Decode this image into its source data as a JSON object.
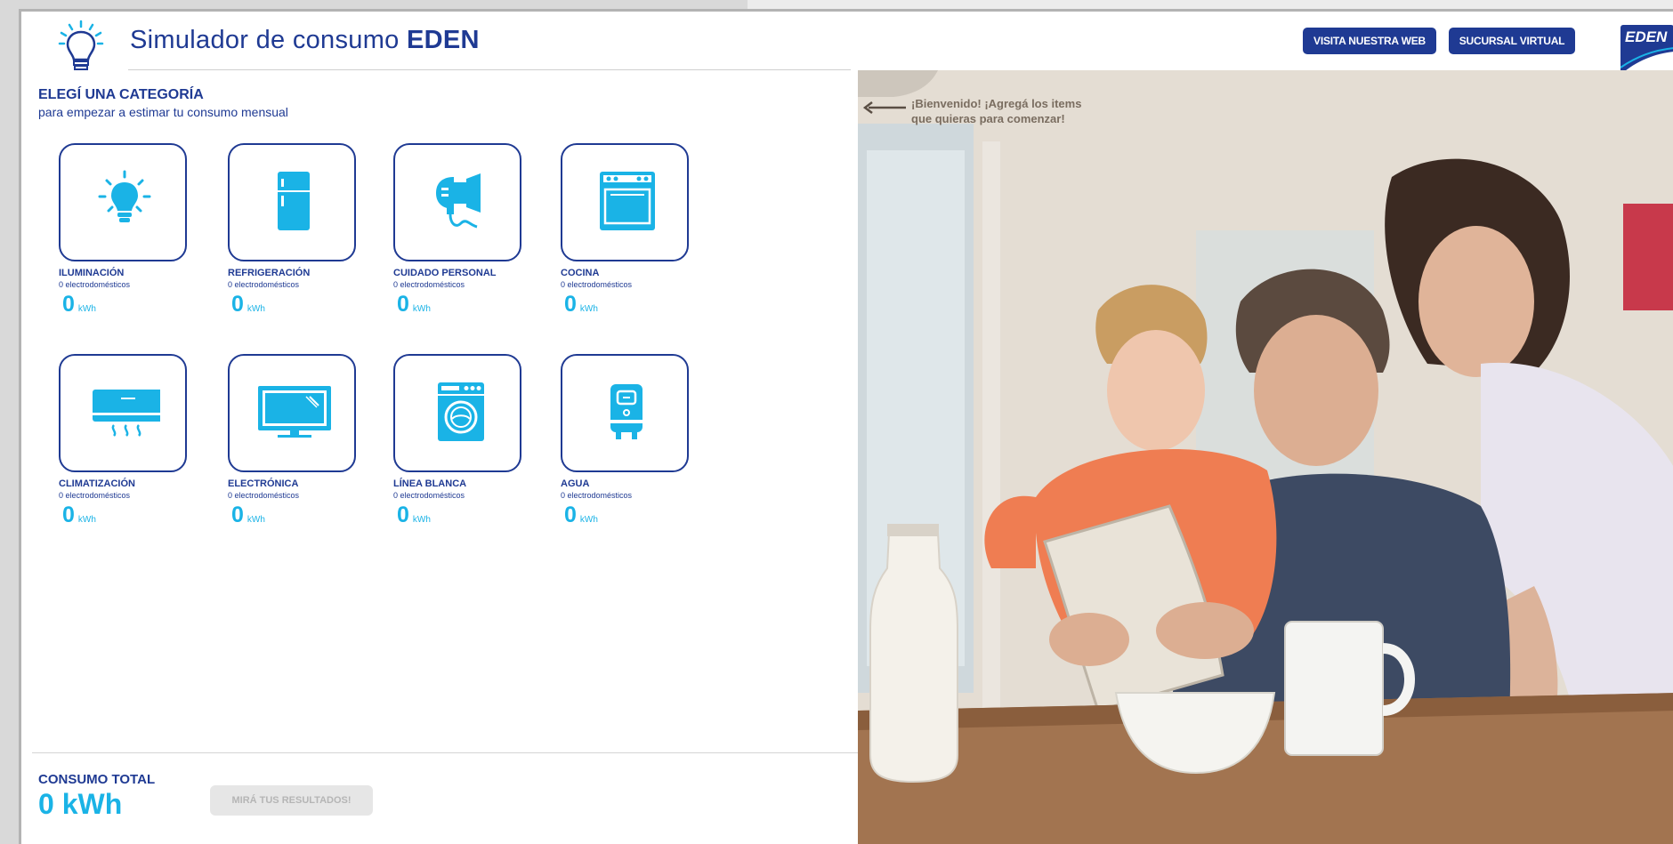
{
  "header": {
    "title_prefix": "Simulador de consumo",
    "title_brand": "EDEN",
    "web_button": "VISITA NUESTRA WEB",
    "virtual_button": "SUCURSAL VIRTUAL",
    "logo_text": "EDEN"
  },
  "categories_section": {
    "title": "ELEGÍ UNA CATEGORÍA",
    "subtitle": "para empezar a estimar tu consumo mensual"
  },
  "categories": [
    {
      "name": "ILUMINACIÓN",
      "count": "0 electrodomésticos",
      "kwh": "0",
      "unit": "kWh",
      "icon": "lightbulb-icon"
    },
    {
      "name": "REFRIGERACIÓN",
      "count": "0 electrodomésticos",
      "kwh": "0",
      "unit": "kWh",
      "icon": "refrigerator-icon"
    },
    {
      "name": "CUIDADO PERSONAL",
      "count": "0 electrodomésticos",
      "kwh": "0",
      "unit": "kWh",
      "icon": "hair-dryer-icon"
    },
    {
      "name": "COCINA",
      "count": "0 electrodomésticos",
      "kwh": "0",
      "unit": "kWh",
      "icon": "oven-icon"
    },
    {
      "name": "CLIMATIZACIÓN",
      "count": "0 electrodomésticos",
      "kwh": "0",
      "unit": "kWh",
      "icon": "air-conditioner-icon"
    },
    {
      "name": "ELECTRÓNICA",
      "count": "0 electrodomésticos",
      "kwh": "0",
      "unit": "kWh",
      "icon": "tv-icon"
    },
    {
      "name": "LÍNEA BLANCA",
      "count": "0 electrodomésticos",
      "kwh": "0",
      "unit": "kWh",
      "icon": "washing-machine-icon"
    },
    {
      "name": "AGUA",
      "count": "0 electrodomésticos",
      "kwh": "0",
      "unit": "kWh",
      "icon": "water-heater-icon"
    }
  ],
  "total": {
    "label": "CONSUMO TOTAL",
    "value": "0 kWh",
    "results_button": "MIRÁ TUS RESULTADOS!"
  },
  "welcome": {
    "line1": "¡Bienvenido! ¡Agregá los items",
    "line2": "que quieras para comenzar!"
  },
  "colors": {
    "brand_blue": "#1f3a93",
    "accent_cyan": "#1ab3e6"
  }
}
